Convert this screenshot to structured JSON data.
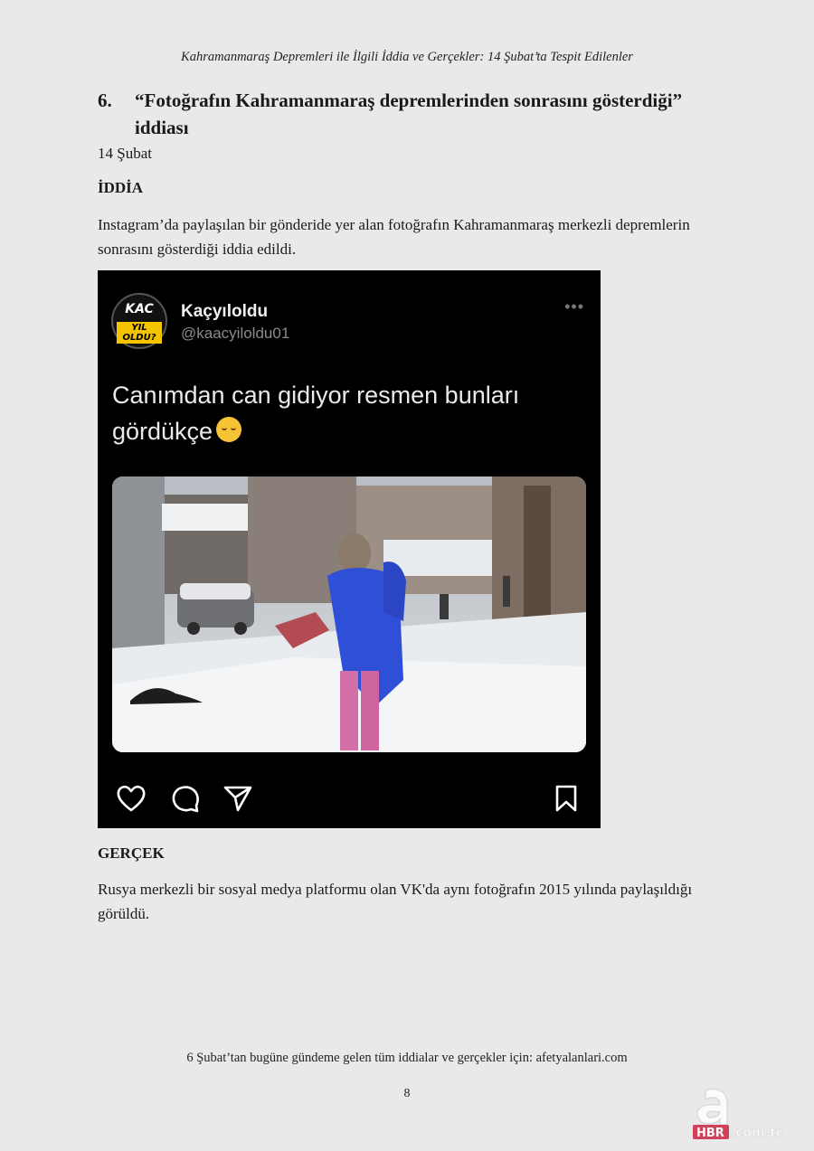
{
  "header": {
    "title": "Kahramanmaraş Depremleri ile İlgili İddia ve Gerçekler: 14 Şubat’ta Tespit Edilenler"
  },
  "section": {
    "number": "6.",
    "title": "“Fotoğrafın Kahramanmaraş depremlerinden sonrasını gösterdiği” iddiası",
    "date": "14 Şubat"
  },
  "claim": {
    "label": "İDDİA",
    "text": "Instagram’da paylaşılan bir gönderide yer alan fotoğrafın Kahramanmaraş merkezli depremlerin sonrasını gösterdiği iddia edildi."
  },
  "post": {
    "avatar_line1": "KAC",
    "avatar_line2": "YIL OLDU?",
    "username": "Kaçyıloldu",
    "handle": "@kaacyiloldu01",
    "caption": "Canımdan can gidiyor resmen bunları gördükçe",
    "more_icon": "more-dots-icon",
    "icons": [
      "heart-icon",
      "comment-icon",
      "share-icon",
      "bookmark-icon"
    ],
    "background": "#000000"
  },
  "fact": {
    "label": "GERÇEK",
    "text": "Rusya merkezli bir sosyal medya platformu olan VK'da aynı fotoğrafın 2015 yılında paylaşıldığı görüldü."
  },
  "footer": {
    "note": "6 Şubat’tan bugüne gündeme gelen tüm iddialar ve gerçekler için: afetyalanlari.com",
    "page_number": "8"
  },
  "watermark": {
    "text": "HBR.com.tr",
    "color": "#c8102e"
  }
}
